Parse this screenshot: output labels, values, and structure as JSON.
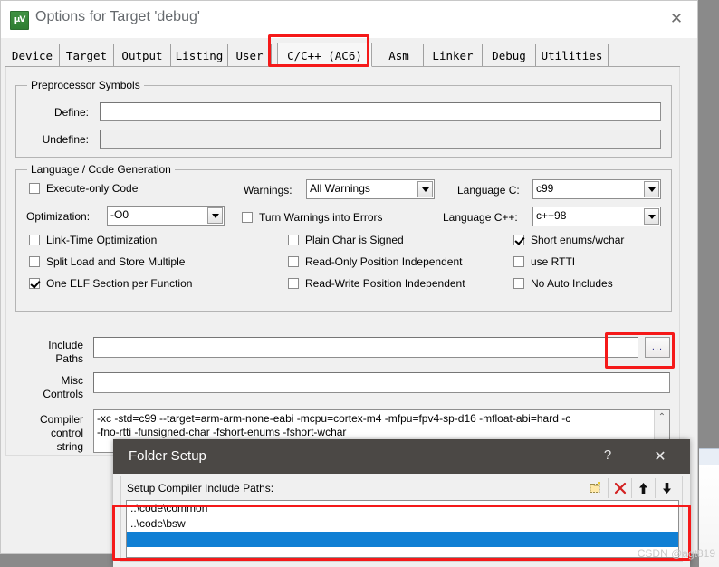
{
  "window": {
    "title": "Options for Target 'debug'",
    "app_icon": "uvision-icon",
    "close_label": "✕"
  },
  "tabs": [
    {
      "label": "Device",
      "selected": false
    },
    {
      "label": "Target",
      "selected": false
    },
    {
      "label": "Output",
      "selected": false
    },
    {
      "label": "Listing",
      "selected": false
    },
    {
      "label": "User",
      "selected": false
    },
    {
      "label": "C/C++ (AC6)",
      "selected": true
    },
    {
      "label": "Asm",
      "selected": false
    },
    {
      "label": "Linker",
      "selected": false
    },
    {
      "label": "Debug",
      "selected": false
    },
    {
      "label": "Utilities",
      "selected": false
    }
  ],
  "preprocessor": {
    "group_title": "Preprocessor Symbols",
    "define_label": "Define:",
    "define_value": "",
    "undefine_label": "Undefine:",
    "undefine_value": ""
  },
  "language": {
    "group_title": "Language / Code Generation",
    "execute_only_code": {
      "label": "Execute-only Code",
      "checked": false
    },
    "optimization_label": "Optimization:",
    "optimization_value": "-O0",
    "link_time_optimization": {
      "label": "Link-Time Optimization",
      "checked": false
    },
    "split_load_store": {
      "label": "Split Load and Store Multiple",
      "checked": false
    },
    "one_elf_section": {
      "label": "One ELF Section per Function",
      "checked": true
    },
    "warnings_label": "Warnings:",
    "warnings_value": "All Warnings",
    "turn_warnings_into_errors": {
      "label": "Turn Warnings into Errors",
      "checked": false
    },
    "plain_char_signed": {
      "label": "Plain Char is Signed",
      "checked": false
    },
    "read_only_position_independent": {
      "label": "Read-Only Position Independent",
      "checked": false
    },
    "read_write_position_independent": {
      "label": "Read-Write Position Independent",
      "checked": false
    },
    "language_c_label": "Language C:",
    "language_c_value": "c99",
    "language_cpp_label": "Language C++:",
    "language_cpp_value": "c++98",
    "short_enums_wchar": {
      "label": "Short enums/wchar",
      "checked": true
    },
    "use_rtti": {
      "label": "use RTTI",
      "checked": false
    },
    "no_auto_includes": {
      "label": "No Auto Includes",
      "checked": false
    }
  },
  "paths": {
    "include_label_line1": "Include",
    "include_label_line2": "Paths",
    "include_value": "",
    "browse_label": "...",
    "misc_label_line1": "Misc",
    "misc_label_line2": "Controls",
    "misc_value": "",
    "compiler_label_line1": "Compiler",
    "compiler_label_line2": "control",
    "compiler_label_line3": "string",
    "compiler_line1": "-xc -std=c99 --target=arm-arm-none-eabi -mcpu=cortex-m4 -mfpu=fpv4-sp-d16 -mfloat-abi=hard -c",
    "compiler_line2": "-fno-rtti -funsigned-char -fshort-enums -fshort-wchar",
    "scroll_up_glyph": "⌃"
  },
  "folder_setup": {
    "title": "Folder Setup",
    "help_label": "?",
    "close_label": "✕",
    "caption": "Setup Compiler Include Paths:",
    "toolbar": [
      {
        "name": "new-folder-icon",
        "glyph": "὜0"
      },
      {
        "name": "delete-icon",
        "glyph": "✕"
      },
      {
        "name": "move-up-icon",
        "glyph": "↑"
      },
      {
        "name": "move-down-icon",
        "glyph": "↓"
      }
    ],
    "paths": [
      {
        "value": "..\\code\\common",
        "selected": false
      },
      {
        "value": "..\\code\\bsw",
        "selected": false
      },
      {
        "value": "",
        "selected": true
      }
    ]
  },
  "watermark": "CSDN @agt819",
  "colors": {
    "highlight_red": "#f51919",
    "selection_blue": "#0f7fd4",
    "dialog_titlebar": "#4b4845",
    "panel_bg": "#f0f0f0"
  }
}
